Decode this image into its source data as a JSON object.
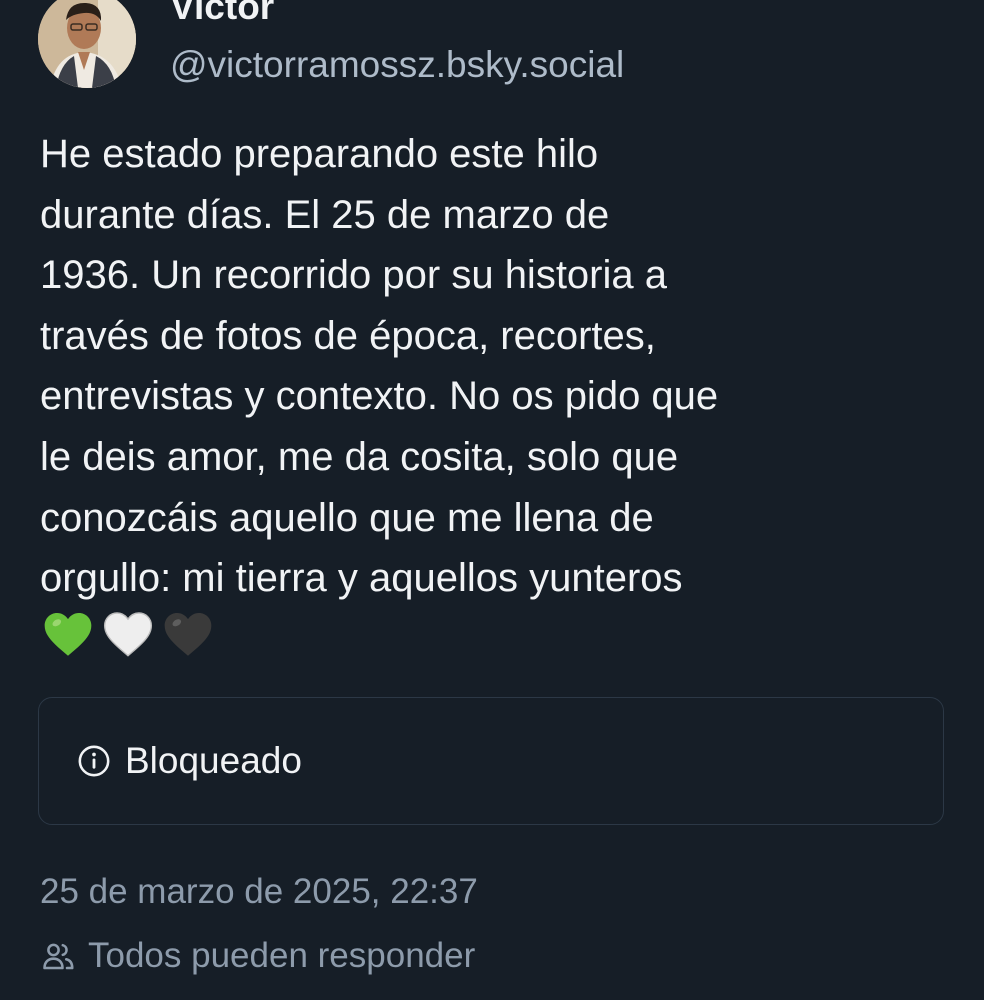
{
  "author": {
    "display_name": "Victor",
    "handle": "@victorramossz.bsky.social"
  },
  "post": {
    "text": "He estado preparando este hilo\ndurante días. El 25 de marzo de\n1936. Un recorrido por su historia a\ntravés de fotos de época, recortes,\nentrevistas y contexto. No os pido que\nle deis amor, me da cosita, solo que\nconozcáis aquello que me llena de\norgullo: mi tierra y aquellos yunteros",
    "emoji": [
      "green-heart-icon",
      "white-heart-icon",
      "black-heart-icon"
    ],
    "embed": {
      "label": "Bloqueado",
      "icon": "info-circle-icon"
    },
    "timestamp": "25 de marzo de 2025, 22:37",
    "reply_setting": {
      "label": "Todos pueden responder",
      "icon": "people-icon"
    }
  },
  "colors": {
    "background": "#161e27",
    "text_primary": "#f1f3f5",
    "text_secondary": "#8d9bab",
    "border": "#2c3846",
    "green_heart": "#67c23a",
    "white_heart": "#eeeeee",
    "black_heart": "#3a3a3a"
  }
}
